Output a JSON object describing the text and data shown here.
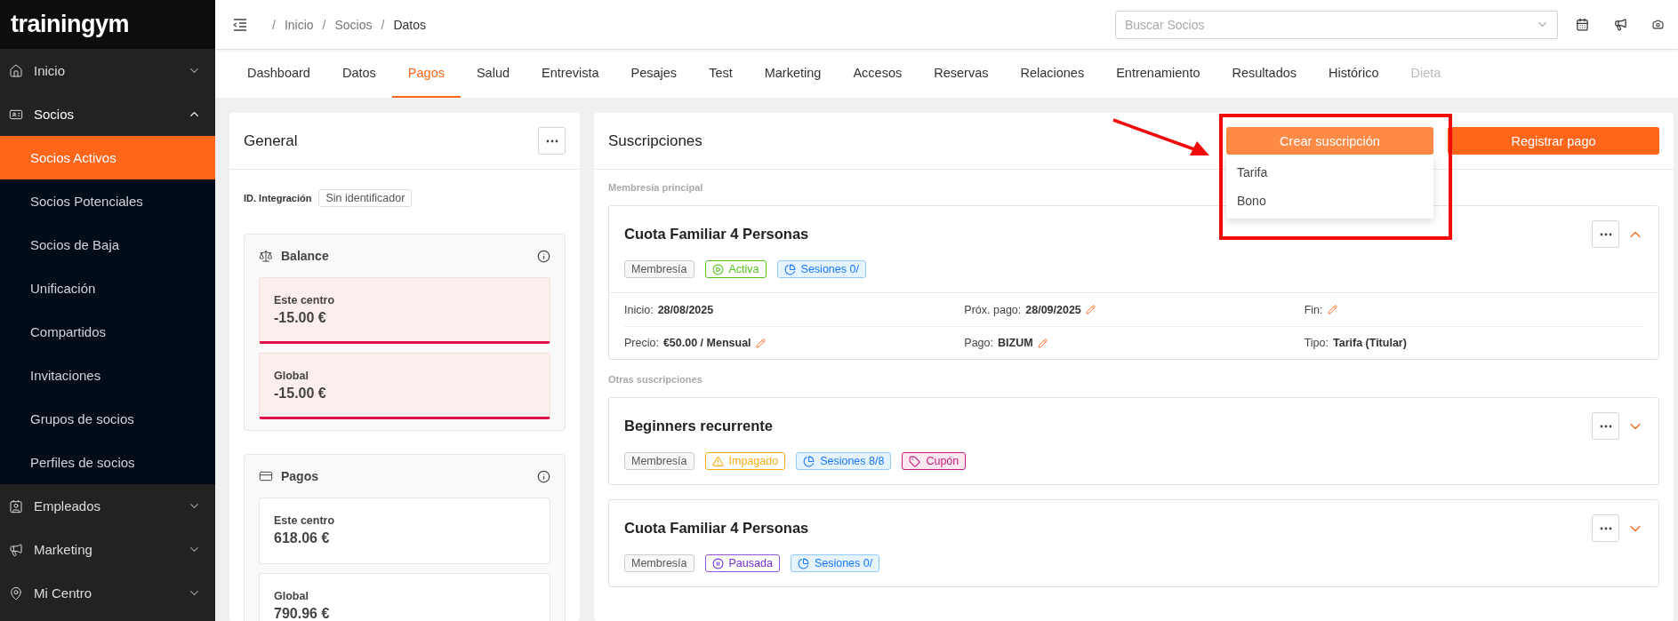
{
  "brand": "trainingym",
  "sidebar": {
    "items": [
      {
        "label": "Inicio",
        "expanded": false
      },
      {
        "label": "Socios",
        "expanded": true,
        "children": [
          {
            "label": "Socios Activos",
            "selected": true
          },
          {
            "label": "Socios Potenciales",
            "selected": false
          },
          {
            "label": "Socios de Baja",
            "selected": false
          },
          {
            "label": "Unificación",
            "selected": false
          },
          {
            "label": "Compartidos",
            "selected": false
          },
          {
            "label": "Invitaciones",
            "selected": false
          },
          {
            "label": "Grupos de socios",
            "selected": false
          },
          {
            "label": "Perfiles de socios",
            "selected": false
          }
        ]
      },
      {
        "label": "Empleados",
        "expanded": false
      },
      {
        "label": "Marketing",
        "expanded": false
      },
      {
        "label": "Mi Centro",
        "expanded": false
      }
    ]
  },
  "breadcrumb": [
    {
      "separator": "/",
      "label": "Inicio"
    },
    {
      "separator": "/",
      "label": "Socios"
    },
    {
      "separator": "/",
      "label": "Datos"
    }
  ],
  "search": {
    "placeholder": "Buscar Socios"
  },
  "tabs": [
    {
      "label": "Dashboard",
      "selected": false,
      "disabled": false
    },
    {
      "label": "Datos",
      "selected": false,
      "disabled": false
    },
    {
      "label": "Pagos",
      "selected": true,
      "disabled": false
    },
    {
      "label": "Salud",
      "selected": false,
      "disabled": false
    },
    {
      "label": "Entrevista",
      "selected": false,
      "disabled": false
    },
    {
      "label": "Pesajes",
      "selected": false,
      "disabled": false
    },
    {
      "label": "Test",
      "selected": false,
      "disabled": false
    },
    {
      "label": "Marketing",
      "selected": false,
      "disabled": false
    },
    {
      "label": "Accesos",
      "selected": false,
      "disabled": false
    },
    {
      "label": "Reservas",
      "selected": false,
      "disabled": false
    },
    {
      "label": "Relaciones",
      "selected": false,
      "disabled": false
    },
    {
      "label": "Entrenamiento",
      "selected": false,
      "disabled": false
    },
    {
      "label": "Resultados",
      "selected": false,
      "disabled": false
    },
    {
      "label": "Histórico",
      "selected": false,
      "disabled": false
    },
    {
      "label": "Dieta",
      "selected": false,
      "disabled": true
    }
  ],
  "general": {
    "title": "General",
    "integration": {
      "label": "ID. Integración",
      "value": "Sin identificador"
    },
    "sections": [
      {
        "title": "Balance",
        "kind": "balance",
        "cards": [
          {
            "label": "Este centro",
            "amount": "-15.00 €",
            "negative": true
          },
          {
            "label": "Global",
            "amount": "-15.00 €",
            "negative": true
          }
        ]
      },
      {
        "title": "Pagos",
        "kind": "payments",
        "cards": [
          {
            "label": "Este centro",
            "amount": "618.06 €",
            "negative": false
          },
          {
            "label": "Global",
            "amount": "790.96 €",
            "negative": false
          }
        ]
      }
    ]
  },
  "subscriptions": {
    "title": "Suscripciones",
    "create_button": {
      "label": "Crear suscripción",
      "menu": [
        "Tarifa",
        "Bono"
      ]
    },
    "pay_button": {
      "label": "Registrar pago"
    },
    "groups": [
      {
        "heading": "Membresía principal",
        "items": [
          {
            "name": "Cuota Familiar 4 Personas",
            "expanded": true,
            "tags": [
              {
                "kind": "plain",
                "label": "Membresía"
              },
              {
                "kind": "active",
                "label": "Activa"
              },
              {
                "kind": "sessions",
                "label": "Sesiones 0/"
              }
            ],
            "details": [
              {
                "label": "Inicio:",
                "value": "28/08/2025",
                "editable": false
              },
              {
                "label": "Próx. pago:",
                "value": "28/09/2025",
                "editable": true
              },
              {
                "label": "Fin:",
                "editable": true
              },
              {
                "label": "Precio:",
                "value": "€50.00 / Mensual",
                "editable": true
              },
              {
                "label": "Pago:",
                "value": "BIZUM",
                "editable": true
              },
              {
                "label": "Tipo:",
                "value": "Tarifa (Titular)",
                "editable": false
              }
            ]
          }
        ]
      },
      {
        "heading": "Otras suscripciones",
        "items": [
          {
            "name": "Beginners recurrente",
            "expanded": false,
            "tags": [
              {
                "kind": "plain",
                "label": "Membresía"
              },
              {
                "kind": "unpaid",
                "label": "Impagado"
              },
              {
                "kind": "sessions",
                "label": "Sesiones 8/8"
              },
              {
                "kind": "coupon",
                "label": "Cupón"
              }
            ]
          },
          {
            "name": "Cuota Familiar 4 Personas",
            "expanded": false,
            "tags": [
              {
                "kind": "plain",
                "label": "Membresía"
              },
              {
                "kind": "paused",
                "label": "Pausada"
              },
              {
                "kind": "sessions",
                "label": "Sesiones 0/"
              }
            ]
          }
        ]
      }
    ]
  }
}
